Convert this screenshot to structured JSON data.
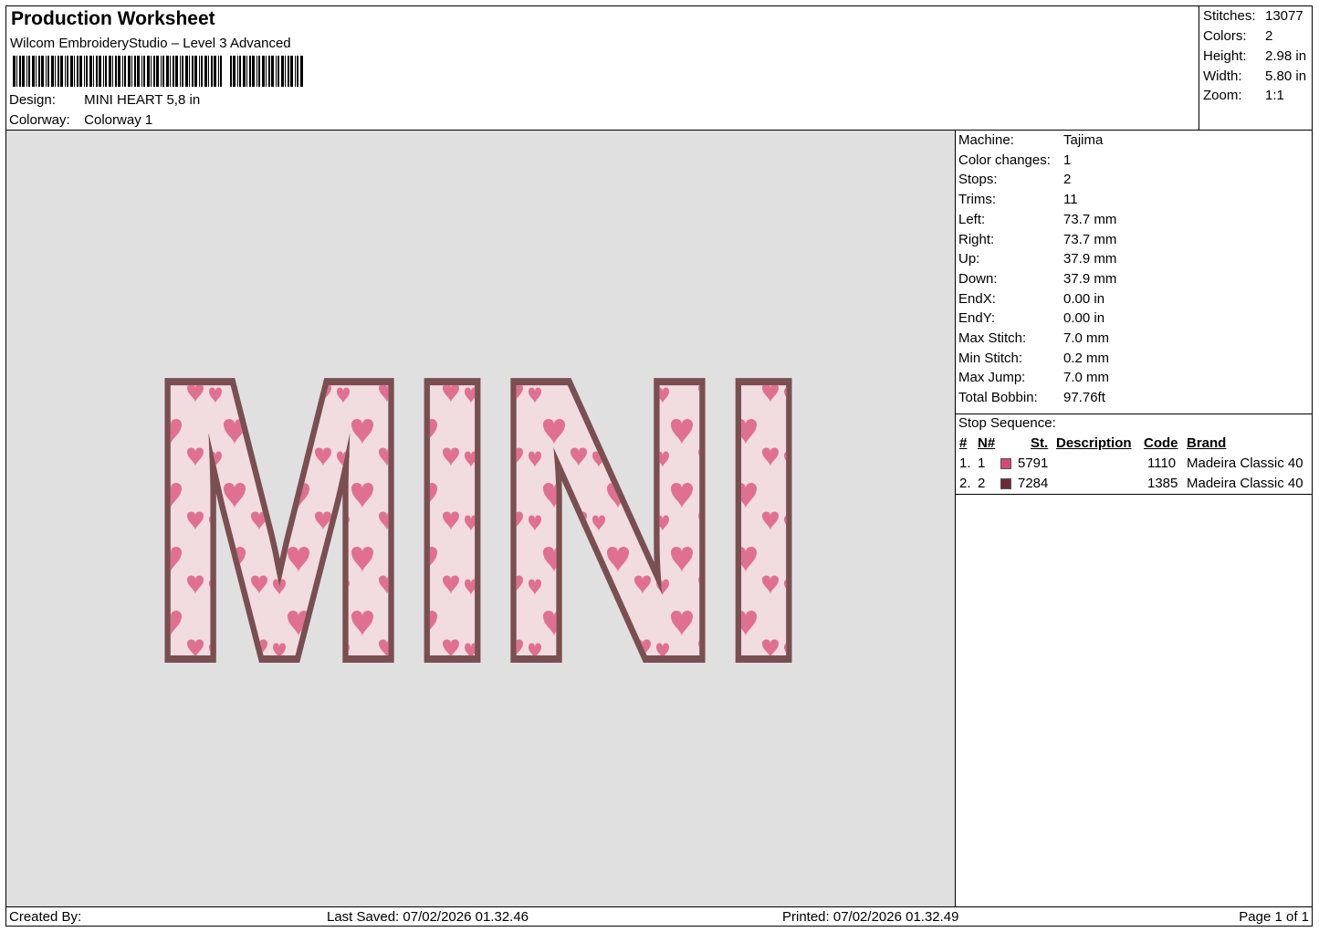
{
  "header": {
    "title": "Production Worksheet",
    "subtitle": "Wilcom EmbroideryStudio – Level 3 Advanced",
    "design_label": "Design:",
    "design_value": "MINI HEART 5,8 in",
    "colorway_label": "Colorway:",
    "colorway_value": "Colorway 1"
  },
  "summary": {
    "stitches_label": "Stitches:",
    "stitches_value": "13077",
    "colors_label": "Colors:",
    "colors_value": "2",
    "height_label": "Height:",
    "height_value": "2.98 in",
    "width_label": "Width:",
    "width_value": "5.80 in",
    "zoom_label": "Zoom:",
    "zoom_value": "1:1"
  },
  "design": {
    "text": "MINI",
    "outline_color": "#7a4f52",
    "fill_color": "#f1dcdf",
    "heart_color": "#e0708f"
  },
  "machine": {
    "rows": [
      {
        "k": "Machine:",
        "v": "Tajima"
      },
      {
        "k": "Color changes:",
        "v": "1"
      },
      {
        "k": "Stops:",
        "v": "2"
      },
      {
        "k": "Trims:",
        "v": "11"
      },
      {
        "k": "Left:",
        "v": "73.7 mm"
      },
      {
        "k": "Right:",
        "v": "73.7 mm"
      },
      {
        "k": "Up:",
        "v": "37.9 mm"
      },
      {
        "k": "Down:",
        "v": "37.9 mm"
      },
      {
        "k": "EndX:",
        "v": "0.00 in"
      },
      {
        "k": "EndY:",
        "v": "0.00 in"
      },
      {
        "k": "Max Stitch:",
        "v": "7.0 mm"
      },
      {
        "k": "Min Stitch:",
        "v": "0.2 mm"
      },
      {
        "k": "Max Jump:",
        "v": "7.0 mm"
      },
      {
        "k": "Total Bobbin:",
        "v": "97.76ft"
      }
    ]
  },
  "stops": {
    "title": "Stop Sequence:",
    "headers": {
      "num": "#",
      "n": "N#",
      "st": "St.",
      "desc": "Description",
      "code": "Code",
      "brand": "Brand"
    },
    "rows": [
      {
        "num": "1.",
        "n": "1",
        "color": "#d14a78",
        "st": "5791",
        "code": "1110",
        "brand": "Madeira Classic 40"
      },
      {
        "num": "2.",
        "n": "2",
        "color": "#6e2a38",
        "st": "7284",
        "code": "1385",
        "brand": "Madeira Classic 40"
      }
    ]
  },
  "footer": {
    "created_by": "Created By:",
    "last_saved": "Last Saved: 07/02/2026 01.32.46",
    "printed": "Printed: 07/02/2026 01.32.49",
    "page": "Page 1 of 1"
  }
}
